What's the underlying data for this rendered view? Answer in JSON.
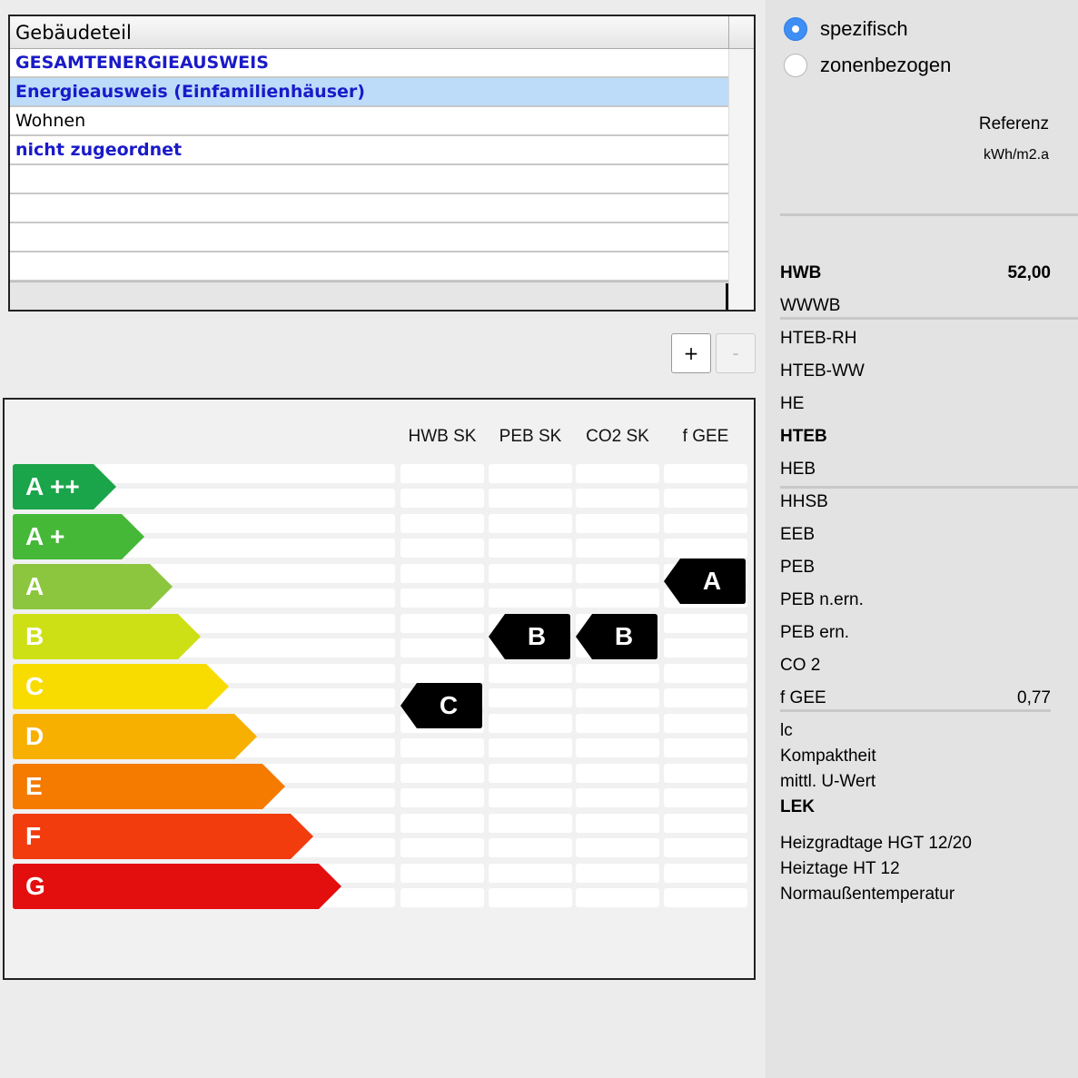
{
  "table": {
    "header": "Gebäudeteil",
    "rows": [
      {
        "label": "GESAMTENERGIEAUSWEIS",
        "bold": true,
        "selected": false
      },
      {
        "label": "Energieausweis  (Einfamilienhäuser)",
        "bold": true,
        "selected": true
      },
      {
        "label": "Wohnen",
        "bold": false,
        "selected": false
      },
      {
        "label": "nicht  zugeordnet",
        "bold": true,
        "selected": false
      },
      {
        "label": "",
        "bold": false,
        "selected": false
      },
      {
        "label": "",
        "bold": false,
        "selected": false
      },
      {
        "label": "",
        "bold": false,
        "selected": false
      },
      {
        "label": "",
        "bold": false,
        "selected": false
      }
    ]
  },
  "buttons": {
    "add": "+",
    "remove": "-"
  },
  "energy": {
    "columns": [
      "HWB SK",
      "PEB SK",
      "CO2 SK",
      "f GEE"
    ],
    "classes": [
      {
        "label": "A ++",
        "color": "#1aa54a"
      },
      {
        "label": "A +",
        "color": "#46b838"
      },
      {
        "label": "A",
        "color": "#8cc63e"
      },
      {
        "label": "B",
        "color": "#cde016"
      },
      {
        "label": "C",
        "color": "#f8dc00"
      },
      {
        "label": "D",
        "color": "#f8b000"
      },
      {
        "label": "E",
        "color": "#f57a00"
      },
      {
        "label": "F",
        "color": "#f23c0e"
      },
      {
        "label": "G",
        "color": "#e30f0f"
      }
    ],
    "markers": [
      {
        "column": "HWB SK",
        "label": "C",
        "class_index": 4
      },
      {
        "column": "PEB SK",
        "label": "B",
        "class_index": 3
      },
      {
        "column": "CO2 SK",
        "label": "B",
        "class_index": 3
      },
      {
        "column": "f GEE",
        "label": "A",
        "class_index": 2
      }
    ]
  },
  "right": {
    "radio": [
      {
        "label": "spezifisch",
        "checked": true
      },
      {
        "label": "zonenbezogen",
        "checked": false
      }
    ],
    "reference_label": "Referenz",
    "unit": "kWh/m2.a",
    "metrics": [
      {
        "label": "HWB",
        "value": "52,00",
        "bold": true
      },
      {
        "label": "WWWB",
        "value": "",
        "bold": false
      },
      {
        "label": "HTEB-RH",
        "value": "",
        "bold": false
      },
      {
        "label": "HTEB-WW",
        "value": "",
        "bold": false
      },
      {
        "label": "HE",
        "value": "",
        "bold": false
      },
      {
        "label": "HTEB",
        "value": "",
        "bold": true
      },
      {
        "label": "HEB",
        "value": "",
        "bold": false
      },
      {
        "label": "HHSB",
        "value": "",
        "bold": false
      },
      {
        "label": "EEB",
        "value": "",
        "bold": false
      },
      {
        "label": "PEB",
        "value": "",
        "bold": false
      },
      {
        "label": "PEB n.ern.",
        "value": "",
        "bold": false
      },
      {
        "label": "PEB ern.",
        "value": "",
        "bold": false
      },
      {
        "label": "CO 2",
        "value": "",
        "bold": false
      },
      {
        "label": "f GEE",
        "value": "0,77",
        "bold": false
      }
    ],
    "extra": [
      {
        "label": "lc",
        "bold": false
      },
      {
        "label": "Kompaktheit",
        "bold": false
      },
      {
        "label": "mittl. U-Wert",
        "bold": false
      },
      {
        "label": "LEK",
        "bold": true
      }
    ],
    "climate": [
      {
        "label": "Heizgradtage HGT 12/20"
      },
      {
        "label": "Heiztage HT 12"
      },
      {
        "label": "Normaußentemperatur"
      }
    ]
  }
}
